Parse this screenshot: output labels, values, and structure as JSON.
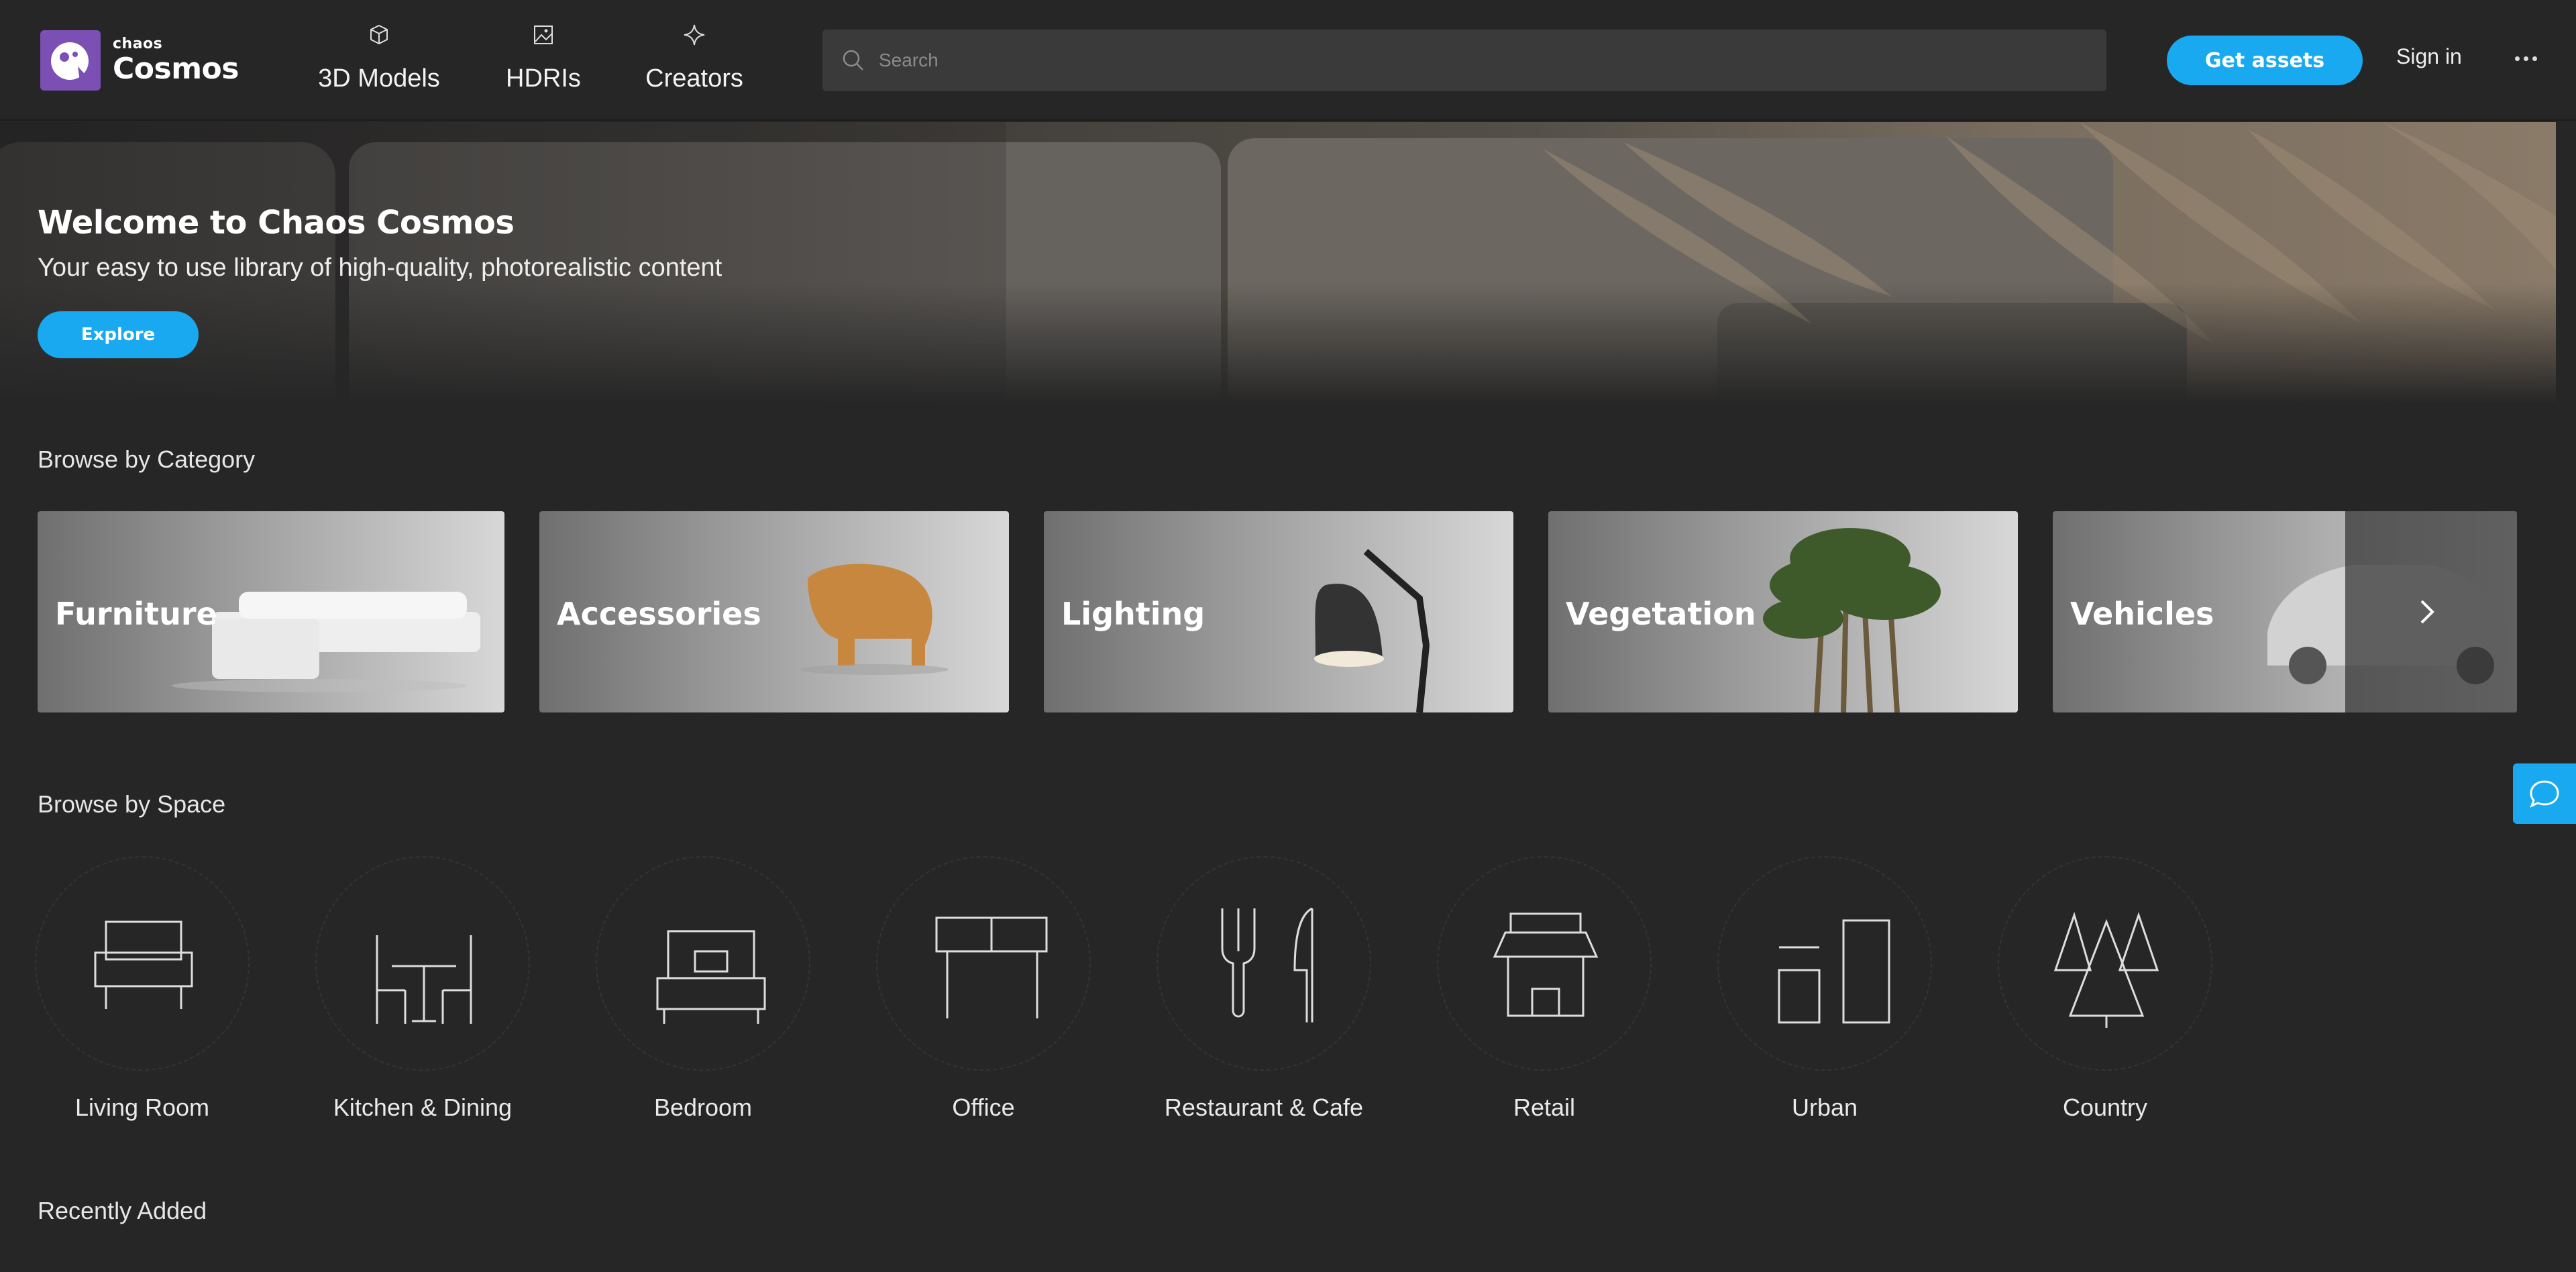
{
  "brand": {
    "small": "chaos",
    "name": "Cosmos"
  },
  "nav": [
    {
      "label": "3D Models",
      "icon": "cube-icon"
    },
    {
      "label": "HDRIs",
      "icon": "image-icon"
    },
    {
      "label": "Creators",
      "icon": "sparkle-icon"
    }
  ],
  "search": {
    "placeholder": "Search"
  },
  "header": {
    "get_assets": "Get assets",
    "sign_in": "Sign in",
    "more_icon": "more-dots-icon"
  },
  "hero": {
    "title": "Welcome to Chaos Cosmos",
    "subtitle": "Your easy to use library of high-quality, photorealistic content",
    "cta": "Explore"
  },
  "categories": {
    "title": "Browse by Category",
    "items": [
      {
        "label": "Furniture"
      },
      {
        "label": "Accessories"
      },
      {
        "label": "Lighting"
      },
      {
        "label": "Vegetation"
      },
      {
        "label": "Vehicles"
      }
    ]
  },
  "spaces": {
    "title": "Browse by Space",
    "items": [
      {
        "label": "Living Room",
        "icon": "sofa-icon"
      },
      {
        "label": "Kitchen & Dining",
        "icon": "dining-table-icon"
      },
      {
        "label": "Bedroom",
        "icon": "bed-icon"
      },
      {
        "label": "Office",
        "icon": "desk-icon"
      },
      {
        "label": "Restaurant & Cafe",
        "icon": "fork-knife-icon"
      },
      {
        "label": "Retail",
        "icon": "storefront-icon"
      },
      {
        "label": "Urban",
        "icon": "buildings-icon"
      },
      {
        "label": "Country",
        "icon": "trees-icon"
      }
    ]
  },
  "recent": {
    "title": "Recently Added"
  },
  "colors": {
    "accent": "#18a9f0",
    "background": "#262626",
    "brand_purple": "#7b4fb3"
  }
}
